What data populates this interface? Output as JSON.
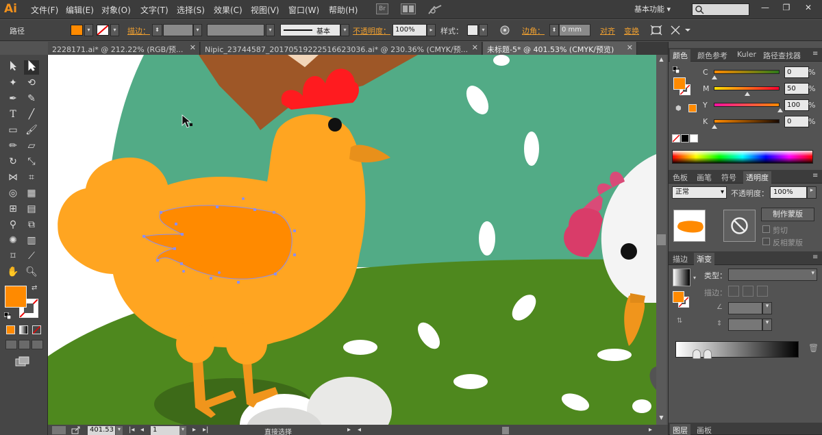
{
  "app": {
    "logo": "Ai",
    "workspace": "基本功能"
  },
  "menu": [
    "文件(F)",
    "编辑(E)",
    "对象(O)",
    "文字(T)",
    "选择(S)",
    "效果(C)",
    "视图(V)",
    "窗口(W)",
    "帮助(H)"
  ],
  "menubar_icons": {
    "bridge": "Br",
    "arrange": "arrange-documents-icon",
    "gpu": "gpu-preview-icon"
  },
  "window_controls": [
    "—",
    "❐",
    "✕"
  ],
  "control_bar": {
    "selection_type": "路径",
    "fill_color": "#ff8a00",
    "stroke_label": "描边：",
    "stroke_style": "基本",
    "opacity_label": "不透明度：",
    "opacity_value": "100%",
    "style_label": "样式：",
    "corner_label": "边角：",
    "corner_value": "0 mm",
    "align_label": "对齐",
    "transform_label": "变换"
  },
  "tabs": [
    {
      "label": "2228171.ai* @ 212.22% (RGB/预...",
      "active": false
    },
    {
      "label": "Nipic_23744587_20170519222516623036.ai* @ 230.36% (CMYK/预...",
      "active": false
    },
    {
      "label": "未标题-5* @ 401.53% (CMYK/预览)",
      "active": true
    }
  ],
  "color_panel": {
    "tabs": [
      "颜色",
      "颜色参考",
      "Kuler",
      "路径查找器"
    ],
    "channels": [
      {
        "label": "C",
        "value": "0"
      },
      {
        "label": "M",
        "value": "50"
      },
      {
        "label": "Y",
        "value": "100"
      },
      {
        "label": "K",
        "value": "0"
      }
    ],
    "fill": "#ff8a00"
  },
  "transparency_panel": {
    "tabs": [
      "色板",
      "画笔",
      "符号",
      "透明度"
    ],
    "blend_mode": "正常",
    "opacity_label": "不透明度：",
    "opacity_value": "100%",
    "make_mask_button": "制作蒙版",
    "clip_label": "剪切",
    "invert_mask_label": "反相蒙版"
  },
  "gradient_panel": {
    "tabs": [
      "描边",
      "渐变"
    ],
    "type_label": "类型：",
    "stroke_label": "描边："
  },
  "bottom_panel_tabs": [
    "图层",
    "画板"
  ],
  "status_bar": {
    "zoom": "401.53",
    "artboard": "1",
    "tool": "直接选择"
  }
}
